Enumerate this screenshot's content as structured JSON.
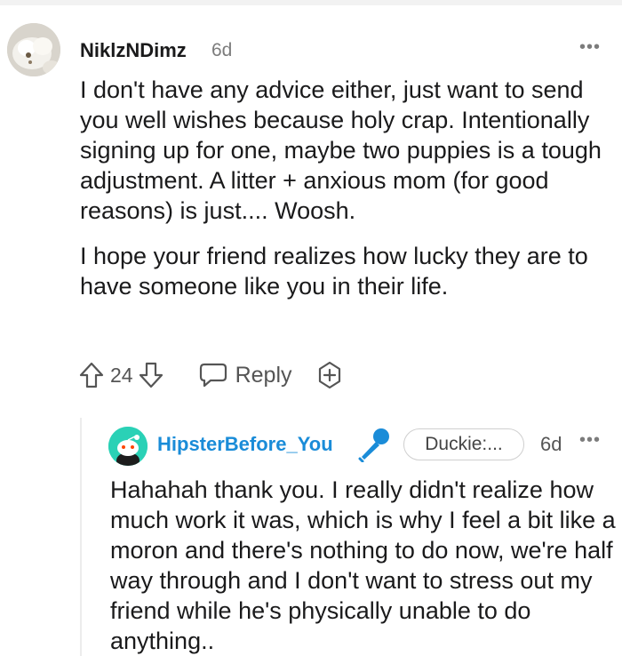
{
  "parent_comment": {
    "username": "NiklzNDimz",
    "age": "6d",
    "paragraphs": [
      "I don't have any advice either, just want to send you well wishes because holy crap. Intentionally signing up for one, maybe two puppies is a tough adjustment. A litter + anxious mom (for good reasons) is just.... Woosh.",
      "I hope your friend realizes how lucky they are to have someone like you in their life."
    ],
    "vote_count": "24",
    "reply_label": "Reply",
    "more_label": "•••"
  },
  "reply_comment": {
    "username": "HipsterBefore_You",
    "flair": "Duckie:...",
    "age": "6d",
    "avatar_color": "#2ad1b6",
    "username_color": "#1a8cd8",
    "more_label": "•••",
    "paragraphs": [
      "Hahahah thank you. I really didn't realize how much work it was, which is why I feel a bit like a moron and there's nothing to do now, we're half way through and I don't want to stress out my friend while he's physically unable to do anything.."
    ]
  },
  "icons": {
    "upvote": "upvote-arrow-icon",
    "downvote": "downvote-arrow-icon",
    "reply": "speech-bubble-icon",
    "award": "award-plus-icon",
    "microphone": "microphone-icon"
  }
}
